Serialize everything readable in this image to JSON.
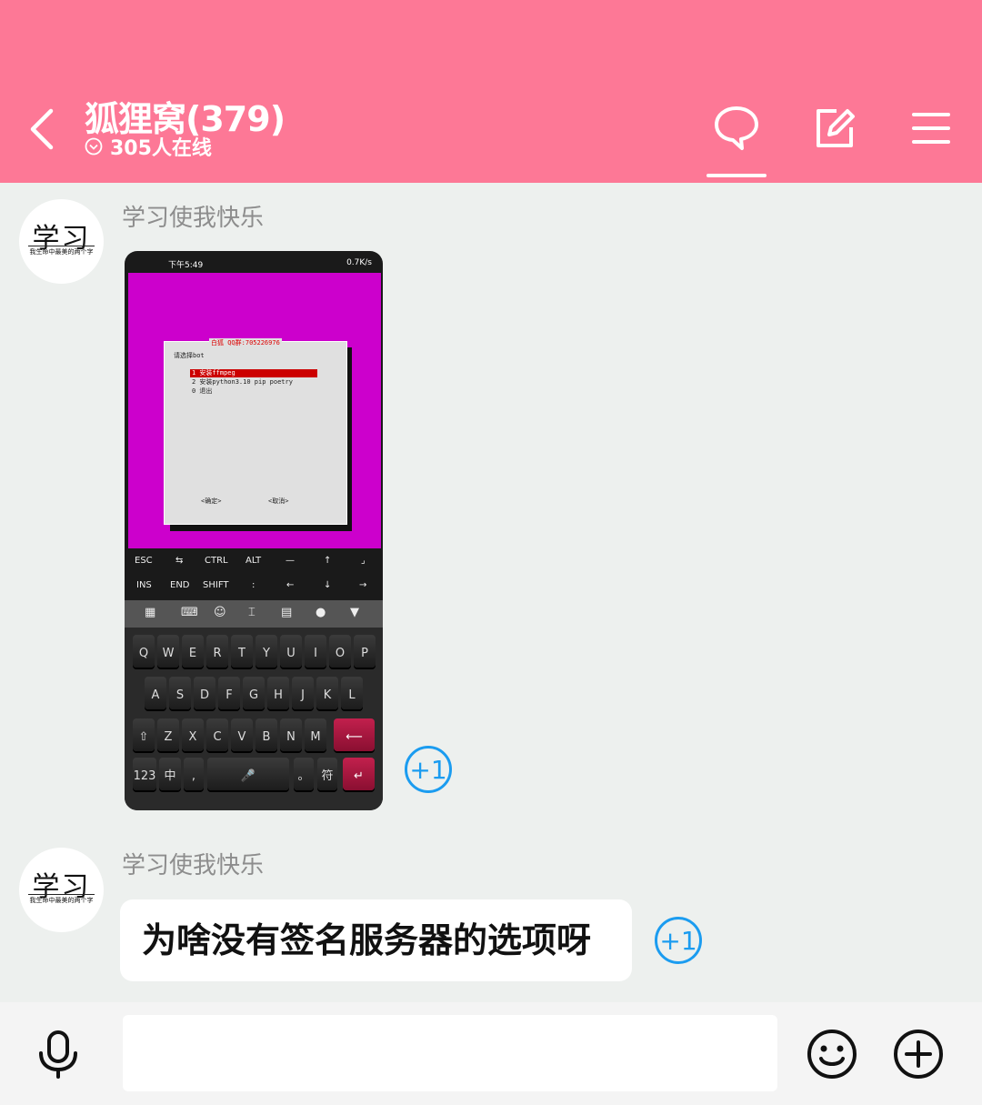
{
  "header": {
    "title": "狐狸窝(379)",
    "online_text": "305人在线"
  },
  "messages": [
    {
      "sender": "学习使我快乐",
      "avatar_main": "学习",
      "avatar_sub": "我生命中最美的两个字",
      "type": "image",
      "plus_one": "+1",
      "screenshot": {
        "time": "下午5:49",
        "status_right": "0.7K/s",
        "dialog_title": "白狐 QQ群:705226976",
        "dialog_prompt": "请选择bot",
        "options": [
          "1 安装ffmpeg",
          "2 安装python3.10 pip poetry",
          "0 退出"
        ],
        "ok_label": "<确定>",
        "cancel_label": "<取消>",
        "extra_keys_row1": [
          "ESC",
          "⇆",
          "CTRL",
          "ALT",
          "—",
          "↑",
          "⌟"
        ],
        "extra_keys_row2": [
          "INS",
          "END",
          "SHIFT",
          ":",
          "←",
          "↓",
          "→"
        ],
        "keyboard_row1": [
          "Q",
          "W",
          "E",
          "R",
          "T",
          "Y",
          "U",
          "I",
          "O",
          "P"
        ],
        "keyboard_row2": [
          "A",
          "S",
          "D",
          "F",
          "G",
          "H",
          "J",
          "K",
          "L"
        ],
        "keyboard_row3": [
          "⇧",
          "Z",
          "X",
          "C",
          "V",
          "B",
          "N",
          "M",
          "⟵"
        ],
        "keyboard_row4": [
          "123",
          "中",
          ",",
          "🎤",
          "。",
          "符",
          "↵"
        ]
      }
    },
    {
      "sender": "学习使我快乐",
      "avatar_main": "学习",
      "avatar_sub": "我生命中最美的两个字",
      "type": "text",
      "text": "为啥没有签名服务器的选项呀",
      "plus_one": "+1"
    }
  ],
  "input": {
    "placeholder": ""
  },
  "colors": {
    "header_bg": "#fd7896",
    "accent_blue": "#1b9cf0",
    "chat_bg": "#edf0ee"
  }
}
